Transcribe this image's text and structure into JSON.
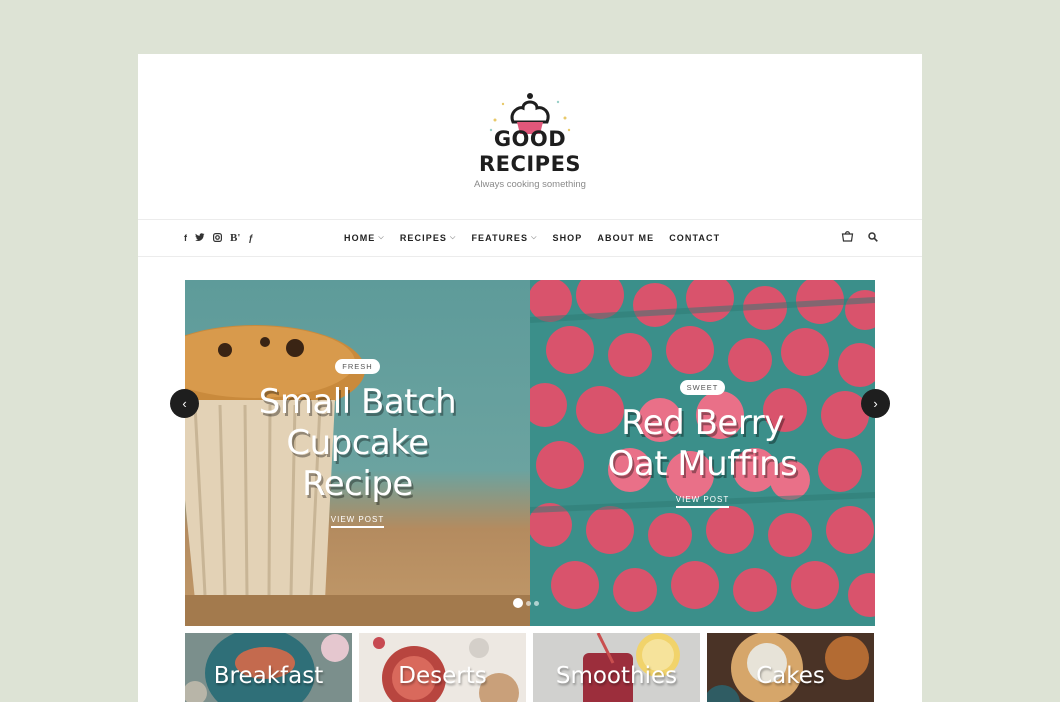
{
  "logo": {
    "line1": "GOOD",
    "line2": "RECIPES",
    "tagline": "Always cooking something"
  },
  "nav": {
    "social": [
      {
        "icon": "facebook-icon",
        "glyph": "f"
      },
      {
        "icon": "twitter-icon",
        "glyph": "🐦"
      },
      {
        "icon": "instagram-icon",
        "glyph": "◎"
      },
      {
        "icon": "bloglovin-icon",
        "glyph": "B'"
      },
      {
        "icon": "foursquare-icon",
        "glyph": "ƒ"
      }
    ],
    "menu": [
      {
        "label": "HOME",
        "dropdown": true
      },
      {
        "label": "RECIPES",
        "dropdown": true
      },
      {
        "label": "FEATURES",
        "dropdown": true
      },
      {
        "label": "SHOP",
        "dropdown": false
      },
      {
        "label": "ABOUT ME",
        "dropdown": false
      },
      {
        "label": "CONTACT",
        "dropdown": false
      }
    ],
    "icons": [
      "cart-icon",
      "search-icon"
    ]
  },
  "slider": {
    "slides": [
      {
        "badge": "FRESH",
        "title_lines": [
          "Small Batch",
          "Cupcake",
          "Recipe"
        ],
        "cta": "VIEW POST"
      },
      {
        "badge": "SWEET",
        "title_lines": [
          "Red Berry",
          "Oat Muffins"
        ],
        "cta": "VIEW POST"
      }
    ],
    "arrows": {
      "prev": "‹",
      "next": "›"
    },
    "dots": 3,
    "active_dot": 0
  },
  "categories": [
    {
      "label": "Breakfast"
    },
    {
      "label": "Deserts"
    },
    {
      "label": "Smoothies"
    },
    {
      "label": "Cakes"
    }
  ],
  "colors": {
    "background": "#dde3d5",
    "dark": "#1e1e1e",
    "accent_pink": "#e0577a"
  }
}
